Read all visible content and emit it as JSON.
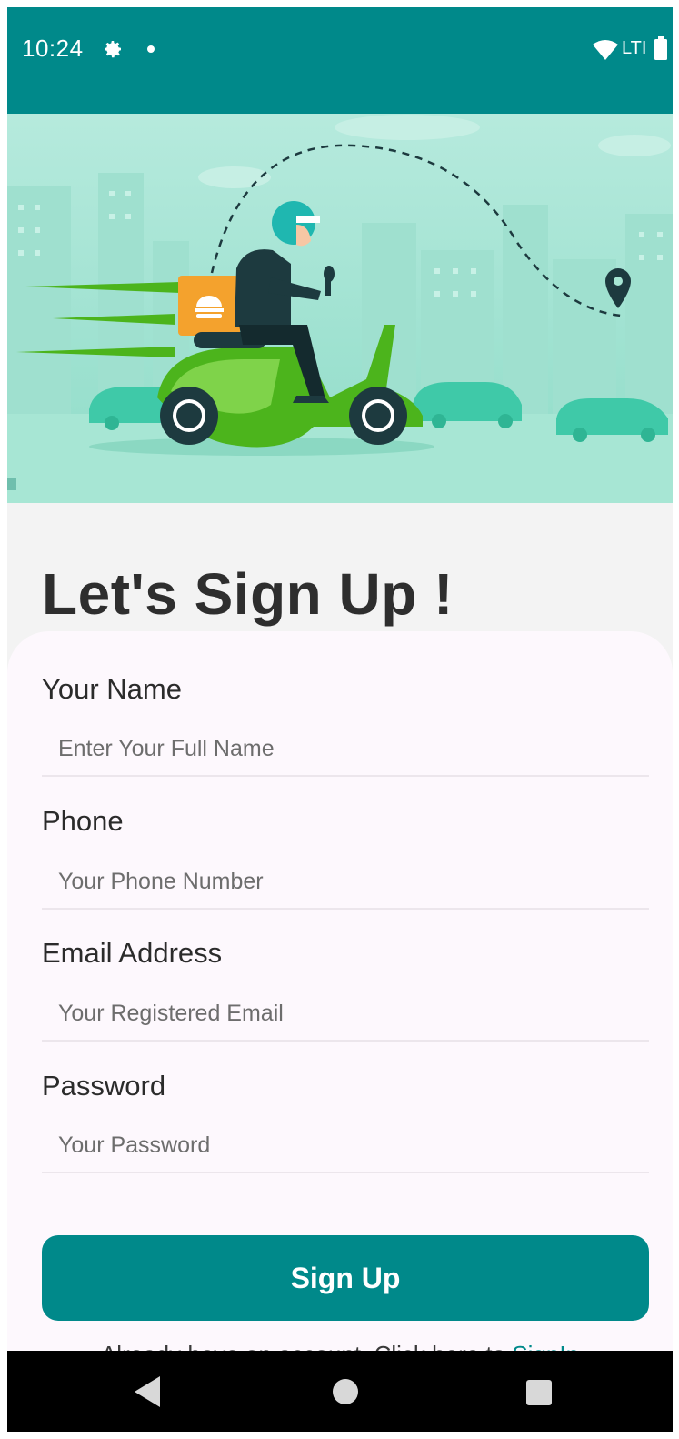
{
  "status_bar": {
    "time": "10:24",
    "network": "LTI",
    "icons": [
      "gear-icon",
      "dot-icon",
      "wifi-icon",
      "battery-icon"
    ]
  },
  "hero": {
    "illustration": "delivery-scooter-illustration"
  },
  "page": {
    "title": "Let's Sign Up !"
  },
  "form": {
    "name": {
      "label": "Your Name",
      "placeholder": "Enter Your Full Name",
      "value": ""
    },
    "phone": {
      "label": "Phone",
      "placeholder": "Your Phone Number",
      "value": ""
    },
    "email": {
      "label": "Email Address",
      "placeholder": "Your Registered Email",
      "value": ""
    },
    "password": {
      "label": "Password",
      "placeholder": "Your Password",
      "value": ""
    },
    "submit_label": "Sign Up",
    "signin_prompt": "Already have an account. Click here to ",
    "signin_link": "SignIn"
  },
  "nav_bar": {
    "icons": [
      "back-icon",
      "home-icon",
      "recents-icon"
    ]
  },
  "colors": {
    "primary": "#00898a",
    "background": "#f3f3f3",
    "card": "#fdf8fd",
    "title": "#2e2e2e"
  }
}
